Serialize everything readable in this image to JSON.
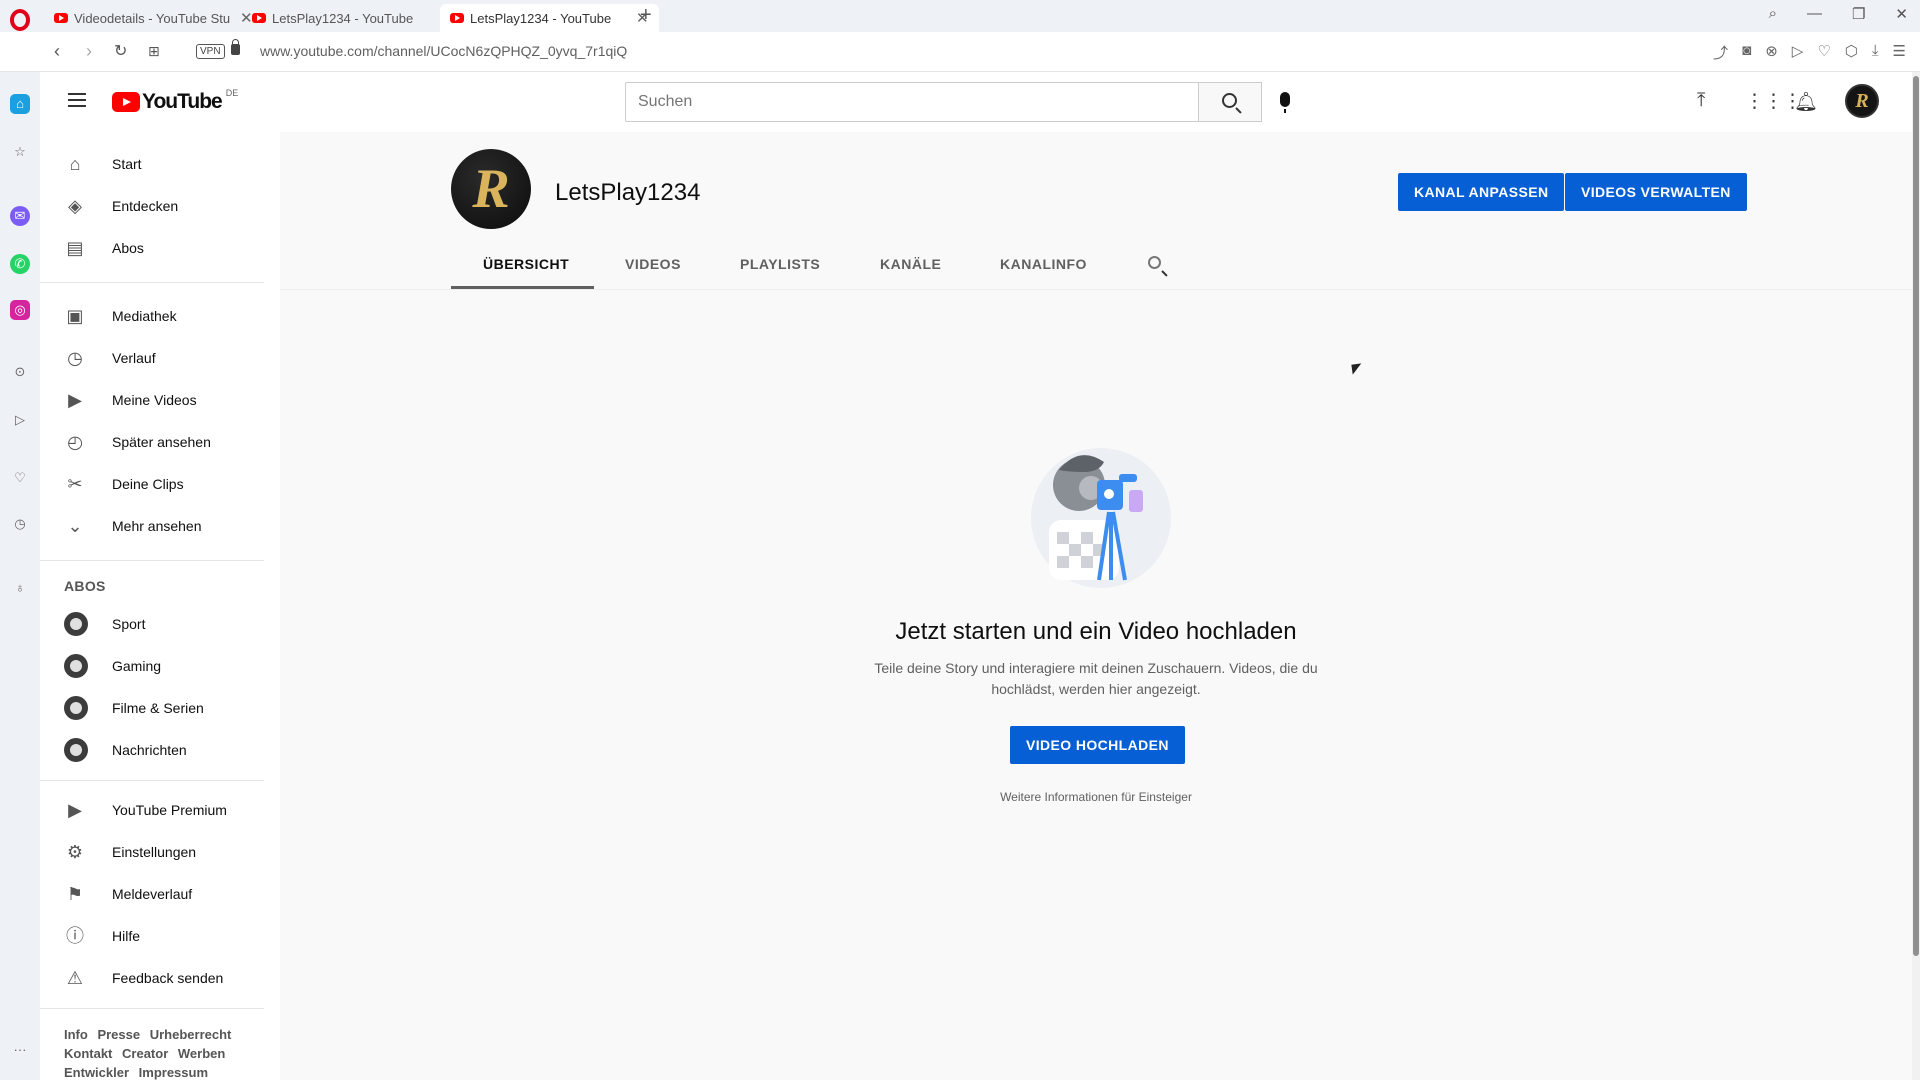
{
  "browser": {
    "tabs": [
      {
        "title": "Videodetails - YouTube Stu"
      },
      {
        "title": "LetsPlay1234 - YouTube"
      },
      {
        "title": "LetsPlay1234 - YouTube"
      }
    ],
    "vpn_label": "VPN",
    "url": "www.youtube.com/channel/UCocN6zQPHQZ_0yvq_7r1qiQ"
  },
  "masthead": {
    "logo_text": "YouTube",
    "country_code": "DE",
    "search_placeholder": "Suchen"
  },
  "nav": {
    "primary": [
      {
        "label": "Start",
        "icon": "home-icon"
      },
      {
        "label": "Entdecken",
        "icon": "compass-icon"
      },
      {
        "label": "Abos",
        "icon": "subscriptions-icon"
      }
    ],
    "library": [
      {
        "label": "Mediathek",
        "icon": "library-icon"
      },
      {
        "label": "Verlauf",
        "icon": "history-icon"
      },
      {
        "label": "Meine Videos",
        "icon": "my-videos-icon"
      },
      {
        "label": "Später ansehen",
        "icon": "watch-later-icon"
      },
      {
        "label": "Deine Clips",
        "icon": "scissors-icon"
      },
      {
        "label": "Mehr ansehen",
        "icon": "chevron-down-icon"
      }
    ],
    "abos_heading": "ABOS",
    "subscriptions": [
      {
        "label": "Sport"
      },
      {
        "label": "Gaming"
      },
      {
        "label": "Filme & Serien"
      },
      {
        "label": "Nachrichten"
      }
    ],
    "more": [
      {
        "label": "YouTube Premium",
        "icon": "youtube-premium-icon"
      },
      {
        "label": "Einstellungen",
        "icon": "gear-icon"
      },
      {
        "label": "Meldeverlauf",
        "icon": "flag-icon"
      },
      {
        "label": "Hilfe",
        "icon": "help-icon"
      },
      {
        "label": "Feedback senden",
        "icon": "feedback-icon"
      }
    ],
    "footer_links": [
      "Info",
      "Presse",
      "Urheberrecht",
      "Kontakt",
      "Creator",
      "Werben",
      "Entwickler",
      "Impressum"
    ]
  },
  "channel": {
    "avatar_letter": "R",
    "name": "LetsPlay1234",
    "customize_button": "KANAL ANPASSEN",
    "manage_button": "VIDEOS VERWALTEN",
    "tabs": [
      "ÜBERSICHT",
      "VIDEOS",
      "PLAYLISTS",
      "KANÄLE",
      "KANALINFO"
    ]
  },
  "empty_state": {
    "title": "Jetzt starten und ein Video hochladen",
    "subtitle": "Teile deine Story und interagiere mit deinen Zuschauern. Videos, die du hochlädst, werden hier angezeigt.",
    "upload_button": "VIDEO HOCHLADEN",
    "more_info": "Weitere Informationen für Einsteiger"
  },
  "colors": {
    "accent": "#065fd4",
    "youtube_red": "#ff0000"
  }
}
